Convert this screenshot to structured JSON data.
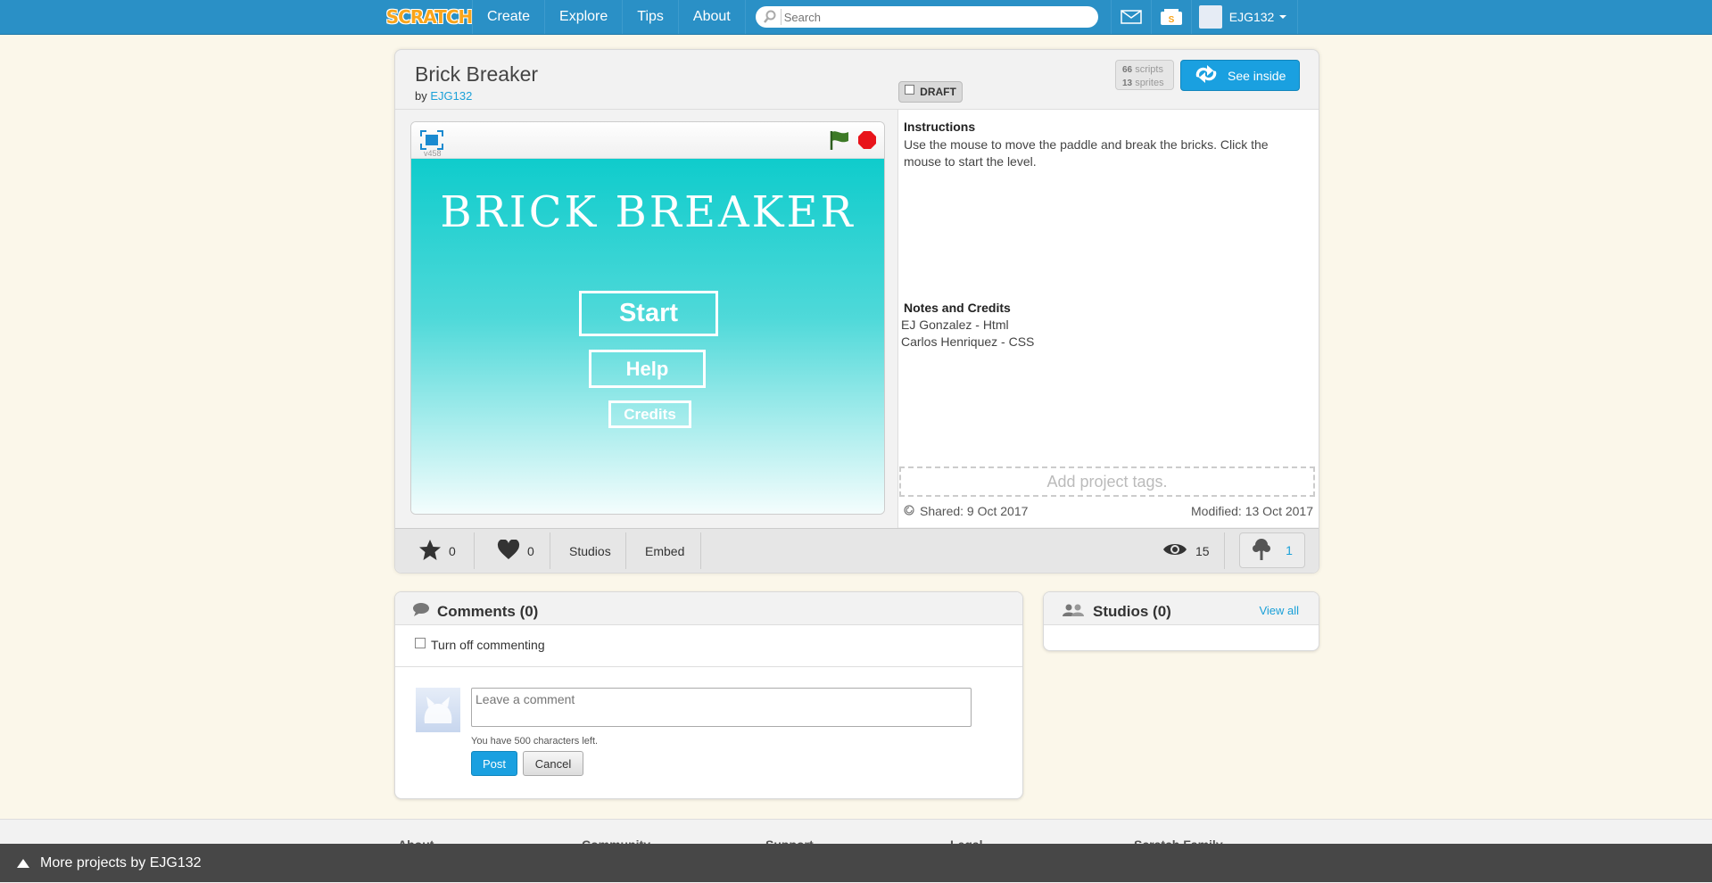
{
  "nav": {
    "logo": "SCRATCH",
    "links": [
      "Create",
      "Explore",
      "Tips",
      "About"
    ],
    "search_placeholder": "Search",
    "username": "EJG132"
  },
  "project": {
    "title": "Brick Breaker",
    "by": "by",
    "author": "EJG132",
    "draft_label": "DRAFT",
    "scripts_count": "66",
    "scripts_label": "scripts",
    "sprites_count": "13",
    "sprites_label": "sprites",
    "see_inside": "See inside",
    "version": "v458",
    "stage": {
      "title": "BRICK BREAKER",
      "start": "Start",
      "help": "Help",
      "credits": "Credits"
    },
    "instructions_heading": "Instructions",
    "instructions_text": "Use the mouse to move the paddle and break the bricks. Click the mouse to start the level.",
    "notes_heading": "Notes and Credits",
    "notes_lines": [
      "EJ Gonzalez - Html",
      "Carlos Henriquez - CSS"
    ],
    "tags_placeholder": "Add project tags.",
    "shared": "Shared: 9 Oct 2017",
    "modified": "Modified: 13 Oct 2017"
  },
  "actions": {
    "stars": "0",
    "loves": "0",
    "studios": "Studios",
    "embed": "Embed",
    "views": "15",
    "remixes": "1"
  },
  "comments": {
    "title": "Comments (0)",
    "turn_off": "Turn off commenting",
    "placeholder": "Leave a comment",
    "chars_left": "You have 500 characters left.",
    "post": "Post",
    "cancel": "Cancel"
  },
  "studios_panel": {
    "title": "Studios (0)",
    "view_all": "View all"
  },
  "footer": {
    "columns": [
      "About",
      "Community",
      "Support",
      "Legal",
      "Scratch Family"
    ],
    "more_projects": "More projects by EJG132"
  },
  "colors": {
    "nav_blue": "#2a90c6",
    "accent_blue": "#1aa0e0",
    "stage_top": "#0fcccc",
    "stop_red": "#e8141b",
    "flag_green": "#2e7d32"
  }
}
